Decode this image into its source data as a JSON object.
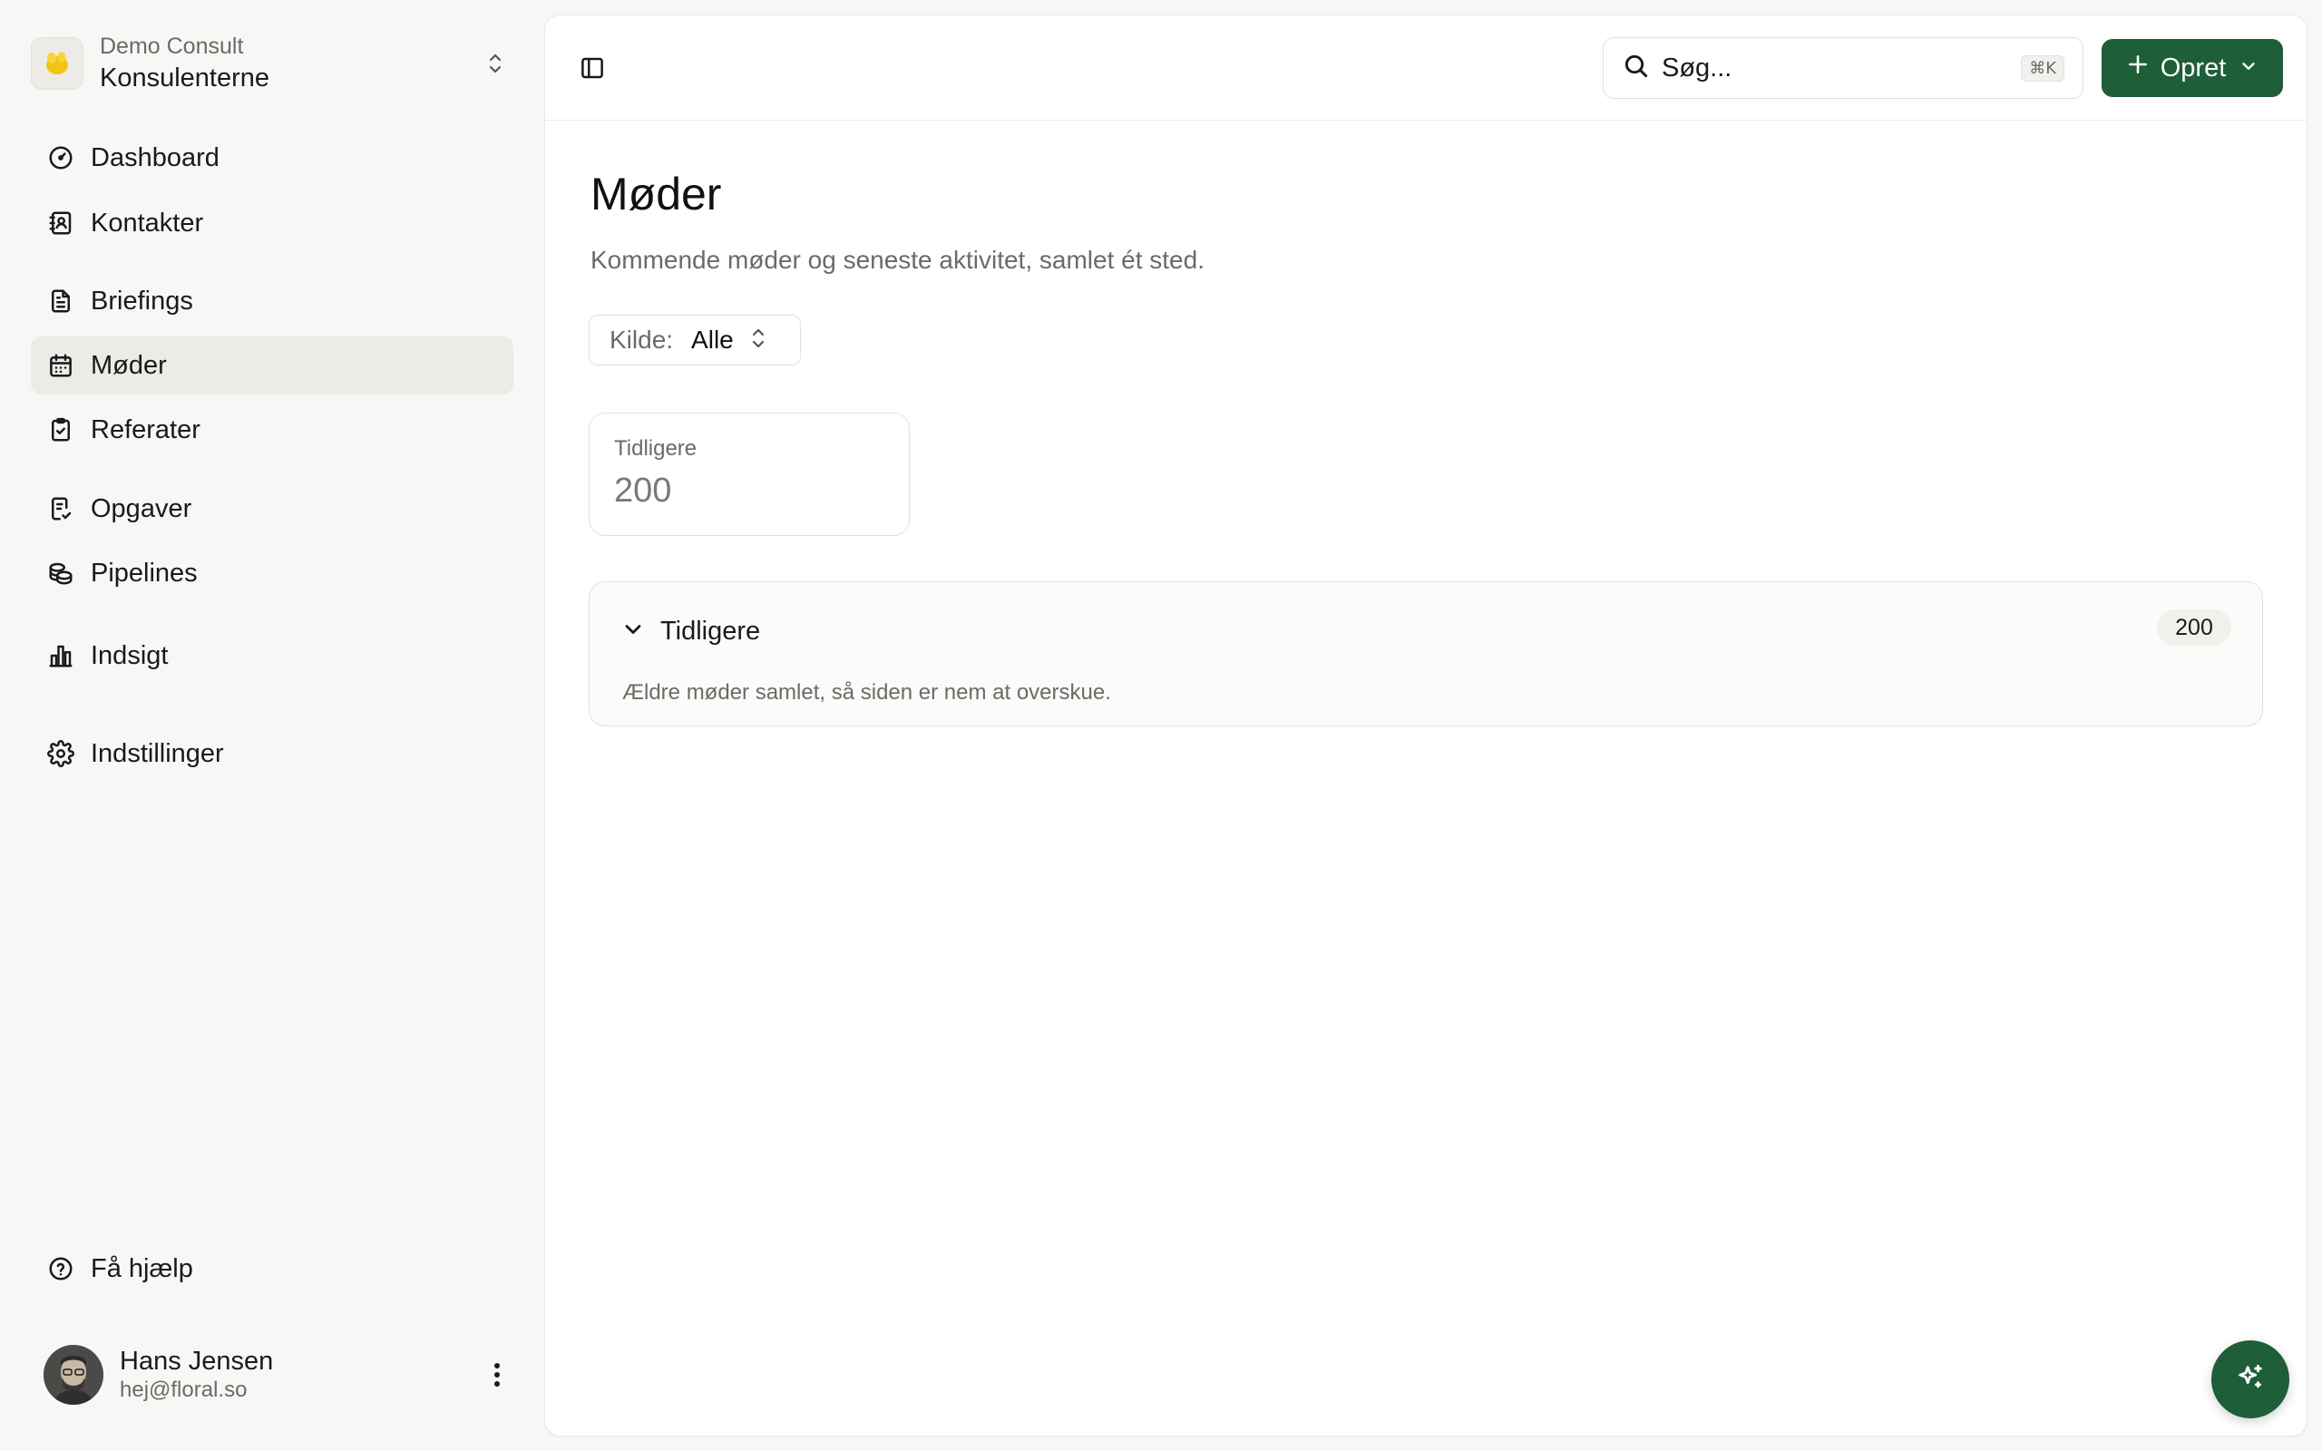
{
  "workspace": {
    "org": "Demo Consult",
    "name": "Konsulenterne"
  },
  "sidebar": {
    "items": [
      {
        "label": "Dashboard",
        "icon": "gauge-icon"
      },
      {
        "label": "Kontakter",
        "icon": "contacts-icon"
      },
      {
        "label": "Briefings",
        "icon": "document-icon"
      },
      {
        "label": "Møder",
        "icon": "calendar-icon",
        "active": true
      },
      {
        "label": "Referater",
        "icon": "clipboard-check-icon"
      },
      {
        "label": "Opgaver",
        "icon": "task-list-icon"
      },
      {
        "label": "Pipelines",
        "icon": "coins-icon"
      },
      {
        "label": "Indsigt",
        "icon": "bar-chart-icon"
      },
      {
        "label": "Indstillinger",
        "icon": "gear-icon"
      }
    ],
    "help_label": "Få hjælp"
  },
  "user": {
    "name": "Hans Jensen",
    "email": "hej@floral.so"
  },
  "topbar": {
    "search_placeholder": "Søg...",
    "search_shortcut": "⌘K",
    "create_label": "Opret"
  },
  "page": {
    "title": "Møder",
    "subtitle": "Kommende møder og seneste aktivitet, samlet ét sted."
  },
  "filter": {
    "label": "Kilde:",
    "value": "Alle"
  },
  "stats": {
    "label": "Tidligere",
    "value": "200"
  },
  "section": {
    "title": "Tidligere",
    "description": "Ældre møder samlet, så siden er nem at overskue.",
    "count": "200"
  },
  "colors": {
    "accent": "#1e5e38",
    "active_nav_bg": "#ecebe8",
    "muted_text": "#6b6b66"
  }
}
